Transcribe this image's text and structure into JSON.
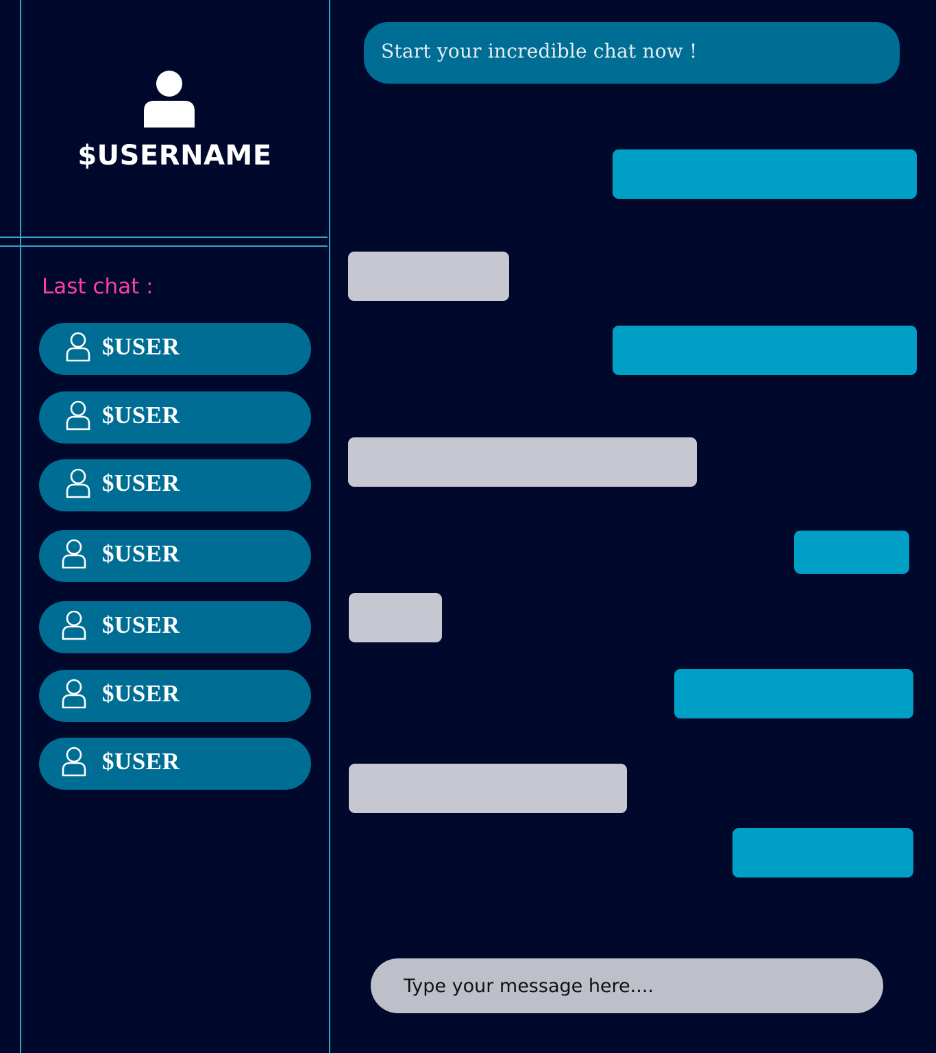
{
  "profile": {
    "avatar_icon": "user-silhouette-icon",
    "username": "$USERNAME"
  },
  "sidebar": {
    "last_chat_label": "Last chat  :",
    "contacts": [
      {
        "label": "$USER",
        "icon": "user-outline-icon"
      },
      {
        "label": "$USER",
        "icon": "user-outline-icon"
      },
      {
        "label": "$USER",
        "icon": "user-outline-icon"
      },
      {
        "label": "$USER",
        "icon": "user-outline-icon"
      },
      {
        "label": "$USER",
        "icon": "user-outline-icon"
      },
      {
        "label": "$USER",
        "icon": "user-outline-icon"
      },
      {
        "label": "$USER",
        "icon": "user-outline-icon"
      }
    ]
  },
  "chat": {
    "header_text": "Start your incredible chat now !",
    "messages": [
      {
        "sender": "me",
        "text": ""
      },
      {
        "sender": "other",
        "text": ""
      },
      {
        "sender": "me",
        "text": ""
      },
      {
        "sender": "other",
        "text": ""
      },
      {
        "sender": "me",
        "text": ""
      },
      {
        "sender": "other",
        "text": ""
      },
      {
        "sender": "me",
        "text": ""
      },
      {
        "sender": "other",
        "text": ""
      },
      {
        "sender": "me",
        "text": ""
      }
    ]
  },
  "composer": {
    "placeholder": "Type your message here....",
    "value": ""
  },
  "colors": {
    "background": "#00082b",
    "divider": "#3aa3c9",
    "pill": "#006e94",
    "sent_bubble": "#00a0c6",
    "received_bubble": "#c7c7d2",
    "accent_label": "#ff3ea5",
    "composer": "#bdc0c9"
  }
}
